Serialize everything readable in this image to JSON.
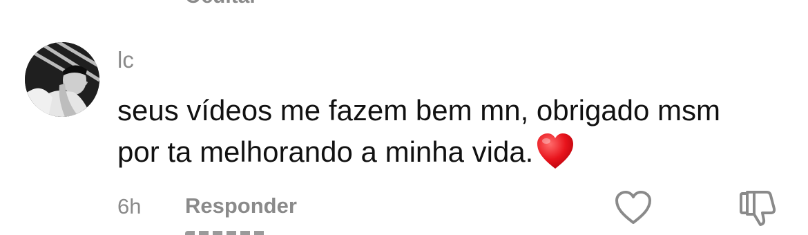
{
  "previous_comment": {
    "cutoff_label": "Ocultar"
  },
  "comment": {
    "username": "lc",
    "text": "seus vídeos me fazem bem mn, obrigado msm por ta melhorando a minha vida.",
    "emoji": "❤️",
    "timestamp": "6h",
    "reply_label": "Responder",
    "icons": {
      "like": "heart-outline-icon",
      "dislike": "thumbs-down-outline-icon"
    }
  }
}
